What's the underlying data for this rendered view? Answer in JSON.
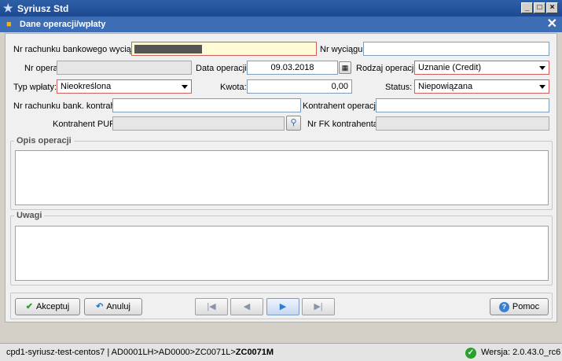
{
  "window": {
    "title": "Syriusz Std",
    "minimize": "_",
    "maximize": "□",
    "close": "×"
  },
  "dialog": {
    "title": "Dane operacji/wpłaty",
    "close": "✕"
  },
  "form": {
    "nr_rachunku_label": "Nr rachunku bankowego wyciągu:",
    "nr_rachunku_value": "",
    "nr_wyciagu_label": "Nr wyciągu:",
    "nr_wyciagu_value": "",
    "nr_operacji_label": "Nr operacji:",
    "nr_operacji_value": "",
    "data_operacji_label": "Data operacji:",
    "data_operacji_value": "09.03.2018",
    "rodzaj_operacji_label": "Rodzaj operacji:",
    "rodzaj_operacji_value": "Uznanie (Credit)",
    "typ_wplaty_label": "Typ wpłaty:",
    "typ_wplaty_value": "Nieokreślona",
    "kwota_label": "Kwota:",
    "kwota_value": "0,00",
    "status_label": "Status:",
    "status_value": "Niepowiązana",
    "nr_rach_kontrah_label": "Nr rachunku bank. kontrah.:",
    "nr_rach_kontrah_value": "",
    "kontrahent_operacji_label": "Kontrahent operacji:",
    "kontrahent_operacji_value": "",
    "kontrahent_pup_label": "Kontrahent PUP:",
    "kontrahent_pup_value": "",
    "nr_fk_label": "Nr FK kontrahenta:",
    "nr_fk_value": ""
  },
  "opis": {
    "title": "Opis operacji",
    "value": ""
  },
  "uwagi": {
    "title": "Uwagi",
    "value": ""
  },
  "buttons": {
    "akceptuj": "Akceptuj",
    "anuluj": "Anuluj",
    "pomoc": "Pomoc",
    "nav_first": "|◀",
    "nav_prev": "◀",
    "nav_next": "▶",
    "nav_last": "▶|"
  },
  "statusbar": {
    "path_prefix": "cpd1-syriusz-test-centos7 | AD0001LH>AD0000>ZC0071L>",
    "path_bold": "ZC0071M",
    "version": "Wersja: 2.0.43.0_rc6"
  },
  "icons": {
    "app": "star-icon",
    "dialog": "document-icon",
    "calendar": "calendar-icon",
    "search": "search-icon",
    "accept": "check-icon",
    "cancel": "undo-icon",
    "help": "help-icon",
    "status_ok": "ok-icon"
  },
  "colors": {
    "titlebar": "#1c4a92",
    "required_border": "#d06060",
    "required_fill": "#fffbd6",
    "ok_green": "#2ca02c"
  }
}
